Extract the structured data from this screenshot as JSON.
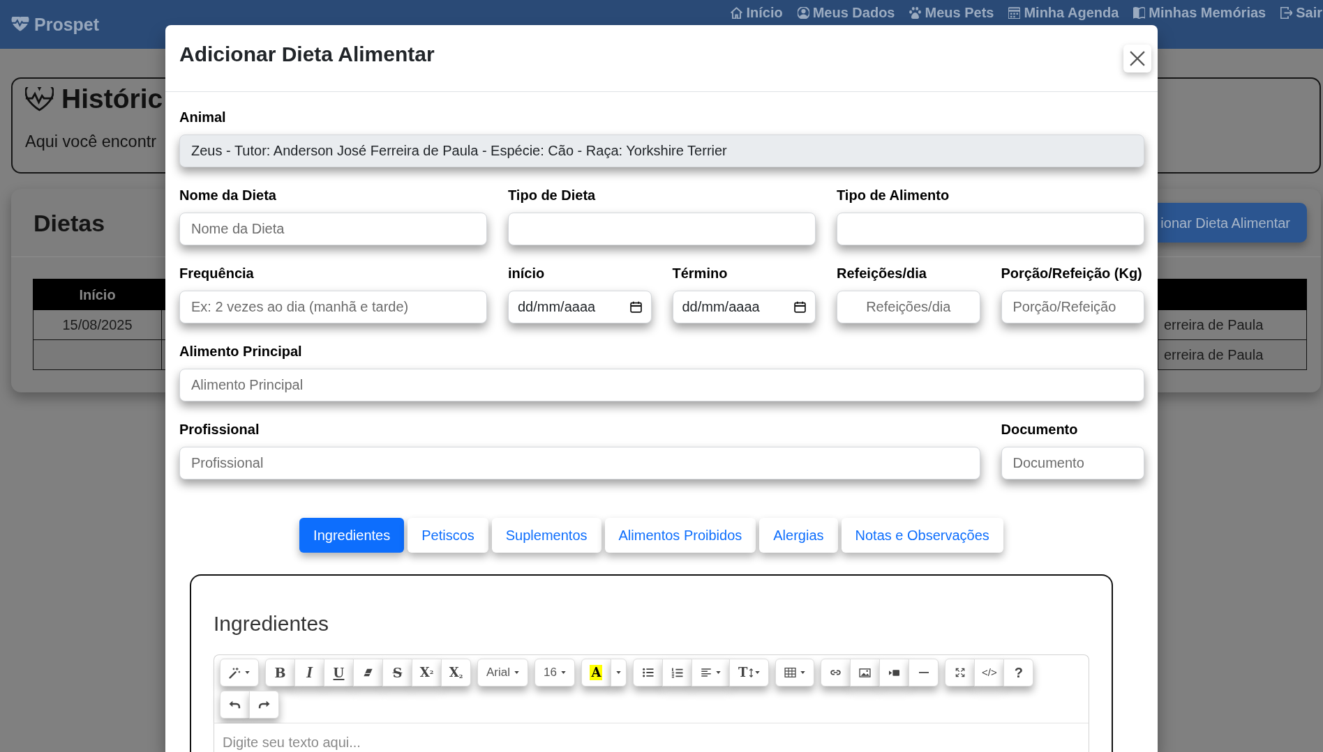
{
  "navbar": {
    "brand": "Prospet",
    "links": [
      {
        "label": "Início"
      },
      {
        "label": "Meus Dados"
      },
      {
        "label": "Meus Pets"
      },
      {
        "label": "Minha Agenda"
      },
      {
        "label": "Minhas Memórias"
      },
      {
        "label": "Sair"
      }
    ]
  },
  "history_card": {
    "title": "Históric",
    "text": "Aqui você encontr"
  },
  "diets_card": {
    "title": "Dietas",
    "add_button": "ionar Dieta Alimentar",
    "table": {
      "columns": [
        "Início"
      ],
      "rows": [
        {
          "start": "15/08/2025",
          "column_last": "erreira de Paula"
        },
        {
          "column_last": "erreira de Paula"
        }
      ]
    }
  },
  "modal": {
    "title": "Adicionar Dieta Alimentar",
    "form_rows": [
      [
        {
          "label": "Animal",
          "kind": "text",
          "value": "Zeus - Tutor: Anderson José Ferreira de Paula - Espécie: Cão - Raça: Yorkshire Terrier",
          "disabled": true
        }
      ],
      [
        {
          "label": "Nome da Dieta",
          "kind": "text",
          "placeholder": "Nome da Dieta",
          "disabled": false
        },
        {
          "label": "Tipo de Dieta",
          "kind": "text",
          "disabled": false
        },
        {
          "label": "Tipo de Alimento",
          "kind": "text",
          "disabled": false
        }
      ],
      [
        {
          "label": "Frequência",
          "kind": "text",
          "placeholder": "Ex: 2 vezes ao dia (manhã e tarde)",
          "disabled": false
        },
        {
          "label": "início",
          "kind": "date",
          "placeholder": "dd/mm/aaaa",
          "disabled": false
        },
        {
          "label": "Término",
          "kind": "date",
          "placeholder": "dd/mm/aaaa",
          "disabled": false
        },
        {
          "label": "Refeições/dia",
          "kind": "number",
          "placeholder": "Refeições/dia",
          "disabled": false
        },
        {
          "label": "Porção/Refeição (Kg)",
          "kind": "text",
          "placeholder": "Porção/Refeição",
          "disabled": false
        }
      ],
      [
        {
          "label": "Alimento Principal",
          "kind": "text",
          "placeholder": "Alimento Principal",
          "disabled": false
        }
      ],
      [
        {
          "label": "Profissional",
          "kind": "text",
          "placeholder": "Profissional",
          "disabled": false
        },
        {
          "label": "Documento",
          "kind": "text",
          "placeholder": "Documento",
          "disabled": false
        }
      ]
    ],
    "tabs": [
      {
        "label": "Ingredientes",
        "selected": true
      },
      {
        "label": "Petiscos",
        "selected": false
      },
      {
        "label": "Suplementos",
        "selected": false
      },
      {
        "label": "Alimentos Proibidos",
        "selected": false
      },
      {
        "label": "Alergias",
        "selected": false
      },
      {
        "label": "Notas e Observações",
        "selected": false
      }
    ],
    "editor": {
      "heading": "Ingredientes",
      "toolbar_rows": [
        [
          {
            "buttons": [
              {
                "kind": "style",
                "dropdown": true
              }
            ]
          },
          {
            "buttons": [
              {
                "kind": "bold",
                "text": "B",
                "dropdown": false
              },
              {
                "kind": "italic",
                "text": "I",
                "dropdown": false
              },
              {
                "kind": "underline",
                "text": "U",
                "dropdown": false
              },
              {
                "kind": "eraser",
                "dropdown": false
              },
              {
                "kind": "strikethrough",
                "text": "S",
                "dropdown": false
              },
              {
                "kind": "superscript",
                "text": "X$^{2}$",
                "dropdown": false
              },
              {
                "kind": "subscript",
                "text": "X$_{2}$",
                "dropdown": false
              }
            ]
          },
          {
            "buttons": [
              {
                "kind": "font-name",
                "text": "Arial",
                "dropdown": true
              }
            ]
          },
          {
            "buttons": [
              {
                "kind": "font-size",
                "text": "16",
                "dropdown": true
              }
            ]
          },
          {
            "buttons": [
              {
                "kind": "highlight",
                "text": "A",
                "dropdown": false
              },
              {
                "kind": "color-menu",
                "dropdown": true
              }
            ]
          },
          {
            "buttons": [
              {
                "kind": "unordered-list",
                "dropdown": false
              },
              {
                "kind": "ordered-list",
                "dropdown": false
              },
              {
                "kind": "align",
                "dropdown": true
              },
              {
                "kind": "line-height",
                "text": "T",
                "dropdown": true
              }
            ]
          },
          {
            "buttons": [
              {
                "kind": "table",
                "dropdown": true
              }
            ]
          },
          {
            "buttons": [
              {
                "kind": "link",
                "dropdown": false
              },
              {
                "kind": "picture",
                "dropdown": false
              },
              {
                "kind": "video",
                "dropdown": false
              },
              {
                "kind": "hr",
                "dropdown": false
              }
            ]
          },
          {
            "buttons": [
              {
                "kind": "fullscreen",
                "dropdown": false
              },
              {
                "kind": "code",
                "text": "</>",
                "dropdown": false
              },
              {
                "kind": "help",
                "text": "?",
                "dropdown": false
              }
            ]
          }
        ],
        [
          {
            "buttons": [
              {
                "kind": "undo",
                "dropdown": false
              },
              {
                "kind": "redo",
                "dropdown": false
              }
            ]
          }
        ]
      ],
      "placeholder": "Digite seu texto aqui..."
    }
  }
}
